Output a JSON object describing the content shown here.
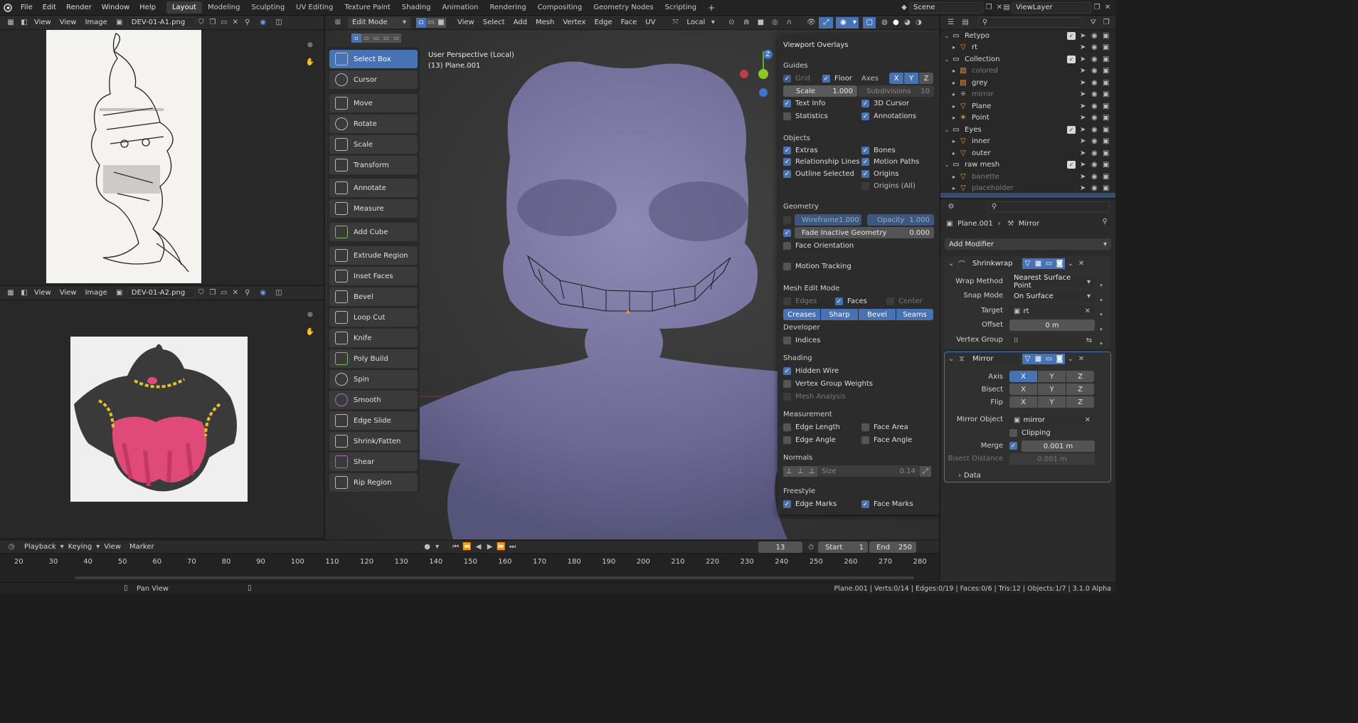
{
  "topbar": {
    "menus": [
      "File",
      "Edit",
      "Render",
      "Window",
      "Help"
    ],
    "workspaces": [
      "Layout",
      "Modeling",
      "Sculpting",
      "UV Editing",
      "Texture Paint",
      "Shading",
      "Animation",
      "Rendering",
      "Compositing",
      "Geometry Nodes",
      "Scripting"
    ],
    "active_workspace": "Layout",
    "add_tab": "+",
    "scene": "Scene",
    "view_layer": "ViewLayer"
  },
  "image_editor_top": {
    "view": "View",
    "menus": [
      "View",
      "Image"
    ],
    "image_name": "DEV-01-A1.png"
  },
  "image_editor_bottom": {
    "view": "View",
    "menus": [
      "View",
      "Image"
    ],
    "image_name": "DEV-01-A2.png"
  },
  "viewport": {
    "mode": "Edit Mode",
    "menus": [
      "View",
      "Select",
      "Add",
      "Mesh",
      "Vertex",
      "Edge",
      "Face",
      "UV"
    ],
    "orientation": "Local",
    "info_line1": "User Perspective (Local)",
    "info_line2": "(13) Plane.001",
    "gizmo_z": "Z"
  },
  "tools": [
    "Select Box",
    "Cursor",
    "Move",
    "Rotate",
    "Scale",
    "Transform",
    "Annotate",
    "Measure",
    "Add Cube",
    "Extrude Region",
    "Inset Faces",
    "Bevel",
    "Loop Cut",
    "Knife",
    "Poly Build",
    "Spin",
    "Smooth",
    "Edge Slide",
    "Shrink/Fatten",
    "Shear",
    "Rip Region"
  ],
  "overlays": {
    "title": "Viewport Overlays",
    "guides": "Guides",
    "grid": "Grid",
    "floor": "Floor",
    "axes": "Axes",
    "ax": "X",
    "ay": "Y",
    "az": "Z",
    "scale_label": "Scale",
    "scale_value": "1.000",
    "subdiv_label": "Subdivisions",
    "subdiv_value": "10",
    "text_info": "Text Info",
    "cursor3d": "3D Cursor",
    "statistics": "Statistics",
    "annotations": "Annotations",
    "objects": "Objects",
    "extras": "Extras",
    "bones": "Bones",
    "rel_lines": "Relationship Lines",
    "motion_paths": "Motion Paths",
    "outline_selected": "Outline Selected",
    "origins": "Origins",
    "origins_all": "Origins (All)",
    "geometry": "Geometry",
    "wireframe": "Wireframe",
    "wireframe_value": "1.000",
    "opacity": "Opacity",
    "opacity_value": "1.000",
    "fade_inactive": "Fade Inactive Geometry",
    "fade_value": "0.000",
    "face_orientation": "Face Orientation",
    "motion_tracking": "Motion Tracking",
    "mesh_edit_mode": "Mesh Edit Mode",
    "edges": "Edges",
    "faces": "Faces",
    "center": "Center",
    "creases": "Creases",
    "sharp": "Sharp",
    "bevel": "Bevel",
    "seams": "Seams",
    "developer": "Developer",
    "indices": "Indices",
    "shading": "Shading",
    "hidden_wire": "Hidden Wire",
    "vgroup_weights": "Vertex Group Weights",
    "mesh_analysis": "Mesh Analysis",
    "measurement": "Measurement",
    "edge_length": "Edge Length",
    "face_area": "Face Area",
    "edge_angle": "Edge Angle",
    "face_angle": "Face Angle",
    "normals": "Normals",
    "size": "Size",
    "size_value": "0.14",
    "freestyle": "Freestyle",
    "edge_marks": "Edge Marks",
    "face_marks": "Face Marks"
  },
  "outliner": {
    "rows": [
      {
        "name": "Retypo",
        "indent": 0,
        "type": "collection"
      },
      {
        "name": "rt",
        "indent": 1,
        "type": "mesh"
      },
      {
        "name": "Collection",
        "indent": 0,
        "type": "collection"
      },
      {
        "name": "colored",
        "indent": 1,
        "type": "image",
        "dim": true
      },
      {
        "name": "grey",
        "indent": 1,
        "type": "image"
      },
      {
        "name": "mirror",
        "indent": 1,
        "type": "empty",
        "dim": true
      },
      {
        "name": "Plane",
        "indent": 1,
        "type": "mesh"
      },
      {
        "name": "Point",
        "indent": 1,
        "type": "light"
      },
      {
        "name": "Eyes",
        "indent": 0,
        "type": "collection"
      },
      {
        "name": "inner",
        "indent": 1,
        "type": "mesh"
      },
      {
        "name": "outer",
        "indent": 1,
        "type": "mesh"
      },
      {
        "name": "raw mesh",
        "indent": 0,
        "type": "collection"
      },
      {
        "name": "banette",
        "indent": 1,
        "type": "mesh",
        "dim": true
      },
      {
        "name": "placeholder",
        "indent": 1,
        "type": "mesh",
        "dim": true
      }
    ]
  },
  "properties": {
    "object": "Plane.001",
    "modifier_ctx": "Mirror",
    "add_modifier": "Add Modifier",
    "shrinkwrap": {
      "name": "Shrinkwrap",
      "wrap_method_label": "Wrap Method",
      "wrap_method": "Nearest Surface Point",
      "snap_mode_label": "Snap Mode",
      "snap_mode": "On Surface",
      "target_label": "Target",
      "target": "rt",
      "offset_label": "Offset",
      "offset": "0 m",
      "vgroup_label": "Vertex Group"
    },
    "mirror": {
      "name": "Mirror",
      "axis_label": "Axis",
      "bisect_label": "Bisect",
      "flip_label": "Flip",
      "x": "X",
      "y": "Y",
      "z": "Z",
      "mirror_object_label": "Mirror Object",
      "mirror_object": "mirror",
      "clipping": "Clipping",
      "merge_label": "Merge",
      "merge": "0.001 m",
      "bisect_distance_label": "Bisect Distance",
      "bisect_distance": "0.001 m",
      "data": "Data"
    }
  },
  "timeline": {
    "menus": [
      "Playback",
      "Keying",
      "View",
      "Marker"
    ],
    "current_frame": "13",
    "start_label": "Start",
    "start": "1",
    "end_label": "End",
    "end": "250",
    "ticks": [
      "20",
      "30",
      "40",
      "50",
      "60",
      "70",
      "80",
      "90",
      "100",
      "110",
      "120",
      "130",
      "140",
      "150",
      "160",
      "170",
      "180",
      "190",
      "200",
      "210",
      "220",
      "230",
      "240",
      "250",
      "260",
      "270",
      "280"
    ]
  },
  "status": {
    "left": "Pan View",
    "right": "Plane.001 | Verts:0/14 | Edges:0/19 | Faces:0/6 | Tris:12 | Objects:1/7 | 3.1.0 Alpha"
  }
}
